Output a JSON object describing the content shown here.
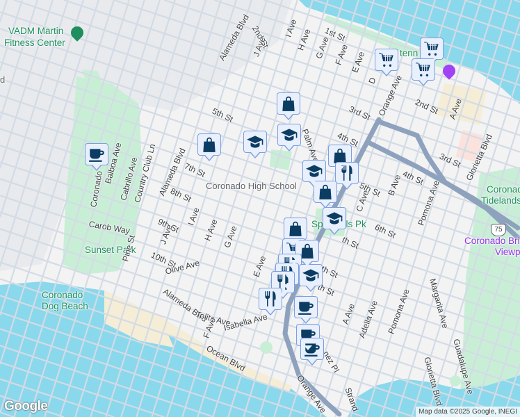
{
  "colors": {
    "water": "#8ad8ec",
    "land": "#f3f3f4",
    "base": "#e8eaed",
    "park": "#c8efd6",
    "sand": "#f6edd6",
    "highway": "#8ea2bd",
    "street": "#d6dde6",
    "marker_bg": "#e8effd",
    "marker_border": "#7b9fe0",
    "icon": "#0b3d63"
  },
  "places": {
    "fitness_line1": "VADM Martin",
    "fitness_line2": "Fitness Center",
    "high_school": "Coronado High School",
    "spreckels": "Spreckels Pk",
    "sunset_park": "Sunset Park",
    "dog_beach_line1": "Coronado",
    "dog_beach_line2": "Dog Beach",
    "tidelands_line1": "Coronado",
    "tidelands_line2": "Tidelands",
    "bridge_line1": "Coronado Bri",
    "bridge_line2": "Viewp",
    "tenn": "tenn",
    "partial_d": "d"
  },
  "streets": [
    "Alameda Blvd",
    "2nd St",
    "J Ave",
    "I Ave",
    "H Ave",
    "G Ave",
    "F Ave",
    "E Ave",
    "D",
    "1st St",
    "3rd St",
    "2nd St",
    "Orange Ave",
    "A Ave",
    "5th St",
    "4th St",
    "4th St",
    "3rd St",
    "Glorietta Blvd",
    "Palm Ave",
    "7th St",
    "8th St",
    "9th St",
    "10th St",
    "Olive Ave",
    "Alameda Blvd",
    "Country Club Ln",
    "Cabrillo Ave",
    "Balboa Ave",
    "Coronado",
    "Carob Way",
    "Pine St",
    "J Ave",
    "I Ave",
    "H Ave",
    "G Ave",
    "5th St",
    "6th St",
    "C Ave",
    "B Ave",
    "Pomona Ave",
    "E Ave",
    "Alameda Blvd",
    "Tolita Ave",
    "Isabella Ave",
    "F Ave",
    "Ocean Blvd",
    "A Ave",
    "Adella Ave",
    "Pomona Ave",
    "Margarita Ave",
    "Guadalupe Ave",
    "Glorietta Blvd",
    "Orange Ave",
    "Strand",
    "nez Pl",
    "th St",
    "th St",
    "th St"
  ],
  "route_shield": "75",
  "markers": [
    "coffee",
    "bag",
    "school",
    "bag",
    "school",
    "cart",
    "cart",
    "cart",
    "bag",
    "school",
    "restaurant",
    "bag",
    "school",
    "bag",
    "cart",
    "bag",
    "restaurant",
    "restaurant",
    "restaurant",
    "school",
    "restaurant",
    "coffee",
    "coffee",
    "coffee"
  ],
  "footer": {
    "logo": "Google",
    "attribution": "Map data ©2025 Google, INEGI"
  }
}
